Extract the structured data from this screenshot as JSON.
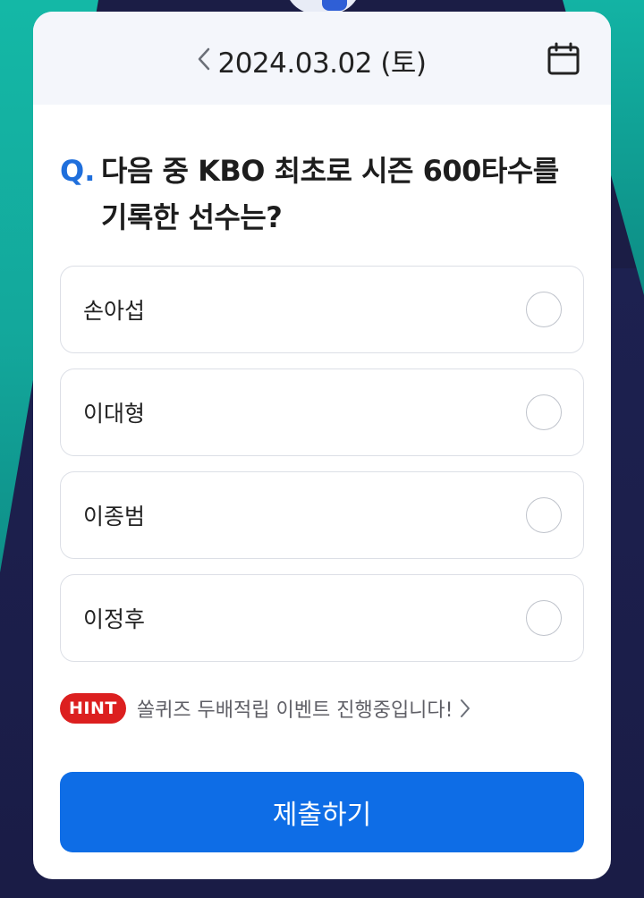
{
  "header": {
    "date": "2024.03.02 (토)",
    "prev_icon": "chevron-left-icon",
    "calendar_icon": "calendar-icon"
  },
  "question": {
    "prefix": "Q.",
    "text": "다음 중 KBO 최초로 시즌 600타수를 기록한 선수는?"
  },
  "options": [
    {
      "label": "손아섭",
      "selected": false
    },
    {
      "label": "이대형",
      "selected": false
    },
    {
      "label": "이종범",
      "selected": false
    },
    {
      "label": "이정후",
      "selected": false
    }
  ],
  "hint": {
    "badge": "HINT",
    "text": "쏠퀴즈 두배적립 이벤트 진행중입니다!",
    "arrow_icon": "chevron-right-icon"
  },
  "submit_label": "제출하기",
  "colors": {
    "accent": "#0e6de6",
    "question_mark": "#1f6fdc",
    "hint_badge": "#dc1f1f",
    "background": "#1b1d45",
    "teal": "#14b8a6"
  }
}
